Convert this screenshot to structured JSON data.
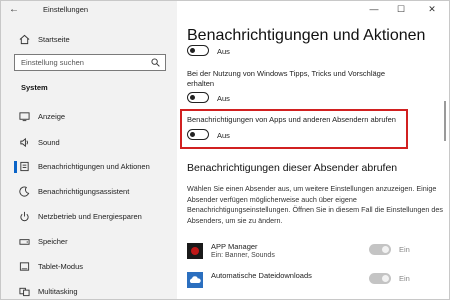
{
  "window": {
    "title": "Einstellungen",
    "minimize": "—",
    "maximize": "☐",
    "close": "✕"
  },
  "sidebar": {
    "back": "←",
    "home_label": "Startseite",
    "search_placeholder": "Einstellung suchen",
    "section": "System",
    "items": [
      {
        "label": "Anzeige",
        "icon": "display-icon"
      },
      {
        "label": "Sound",
        "icon": "speaker-icon"
      },
      {
        "label": "Benachrichtigungen und Aktionen",
        "icon": "notification-icon",
        "active": true
      },
      {
        "label": "Benachrichtigungsassistent",
        "icon": "moon-icon"
      },
      {
        "label": "Netzbetrieb und Energiesparen",
        "icon": "power-icon"
      },
      {
        "label": "Speicher",
        "icon": "storage-icon"
      },
      {
        "label": "Tablet-Modus",
        "icon": "tablet-icon"
      },
      {
        "label": "Multitasking",
        "icon": "multitasking-icon"
      }
    ]
  },
  "main": {
    "title": "Benachrichtigungen und Aktionen",
    "toggle1_state": "Aus",
    "tips_text_line1": "Bei der Nutzung von Windows Tipps, Tricks und Vorschläge",
    "tips_text_line2": "erhalten",
    "toggle2_state": "Aus",
    "apps_text": "Benachrichtigungen von Apps und anderen Absendern abrufen",
    "toggle3_state": "Aus",
    "section_title": "Benachrichtigungen dieser Absender abrufen",
    "description": "Wählen Sie einen Absender aus, um weitere Einstellungen anzuzeigen. Einige Absender verfügen möglicherweise auch über eigene Benachrichtigungseinstellungen. Öffnen Sie in diesem Fall die Einstellungen des Absenders, um sie zu ändern.",
    "apps": [
      {
        "name": "APP Manager",
        "sub": "Ein: Banner, Sounds",
        "state": "Ein"
      },
      {
        "name": "Automatische Dateidownloads",
        "sub": "",
        "state": "Ein"
      }
    ]
  },
  "colors": {
    "accent": "#0a64c8",
    "highlight": "#d12020",
    "sidebar_bg": "#f2f2f2"
  }
}
